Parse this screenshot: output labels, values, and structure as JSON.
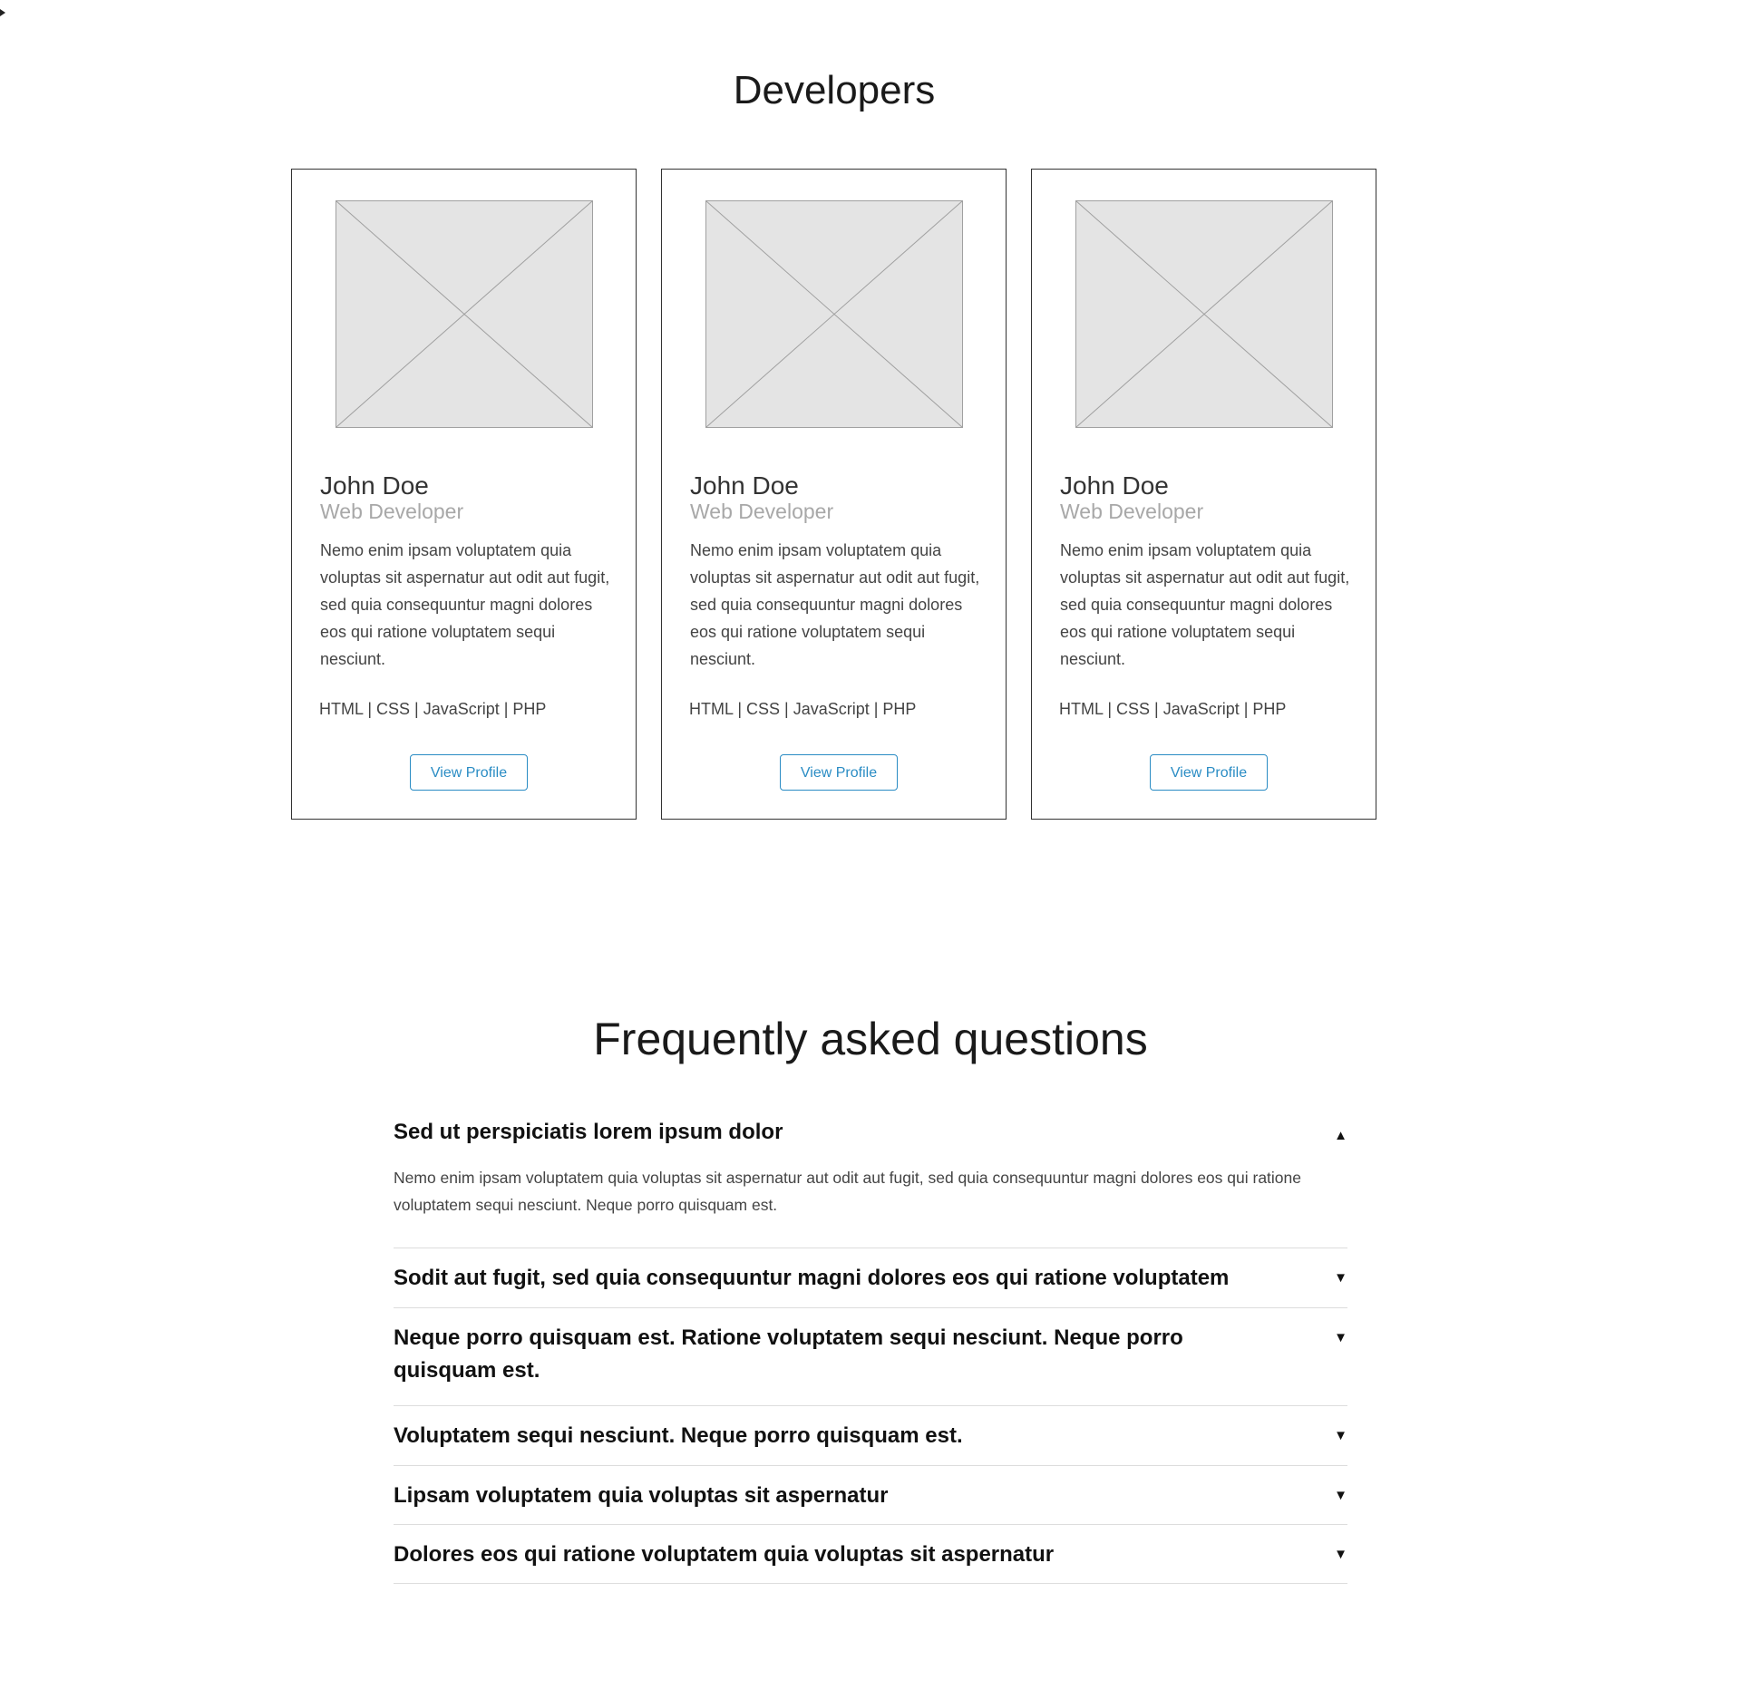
{
  "developers_section": {
    "title": "Developers",
    "cards": [
      {
        "name": "John Doe",
        "role": "Web Developer",
        "bio": "Nemo enim ipsam voluptatem quia voluptas sit aspernatur aut odit aut fugit, sed quia consequuntur magni dolores eos qui ratione voluptatem sequi nesciunt.",
        "skills": "HTML | CSS | JavaScript | PHP",
        "button_label": "View Profile"
      },
      {
        "name": "John Doe",
        "role": "Web Developer",
        "bio": "Nemo enim ipsam voluptatem quia voluptas sit aspernatur aut odit aut fugit, sed quia consequuntur magni dolores eos qui ratione voluptatem sequi nesciunt.",
        "skills": "HTML | CSS | JavaScript | PHP",
        "button_label": "View Profile"
      },
      {
        "name": "John Doe",
        "role": "Web Developer",
        "bio": "Nemo enim ipsam voluptatem quia voluptas sit aspernatur aut odit aut fugit, sed quia consequuntur magni dolores eos qui ratione voluptatem sequi nesciunt.",
        "skills": "HTML | CSS | JavaScript | PHP",
        "button_label": "View Profile"
      }
    ]
  },
  "faq_section": {
    "title": "Frequently asked questions",
    "items": [
      {
        "question": "Sed ut perspiciatis lorem ipsum dolor",
        "expanded": true,
        "arrow": "▲",
        "answer": "Nemo enim ipsam voluptatem quia voluptas sit aspernatur aut odit aut fugit, sed quia consequuntur magni dolores eos qui ratione voluptatem sequi nesciunt. Neque porro quisquam est."
      },
      {
        "question": "Sodit aut fugit, sed quia consequuntur magni dolores eos qui ratione voluptatem",
        "expanded": false,
        "arrow": "▼"
      },
      {
        "question": "Neque porro quisquam est. Ratione voluptatem sequi nesciunt. Neque porro quisquam est.",
        "expanded": false,
        "arrow": "▼"
      },
      {
        "question": "Voluptatem sequi nesciunt. Neque porro quisquam est.",
        "expanded": false,
        "arrow": "▼"
      },
      {
        "question": "Lipsam voluptatem quia voluptas sit aspernatur",
        "expanded": false,
        "arrow": "▼"
      },
      {
        "question": "Dolores eos qui ratione voluptatem quia voluptas sit aspernatur",
        "expanded": false,
        "arrow": "▼"
      }
    ]
  },
  "colors": {
    "accent": "#2a8cc4",
    "placeholder_fill": "#e4e4e4",
    "placeholder_stroke": "#a0a0a0",
    "role_text": "#a8a8a8"
  }
}
